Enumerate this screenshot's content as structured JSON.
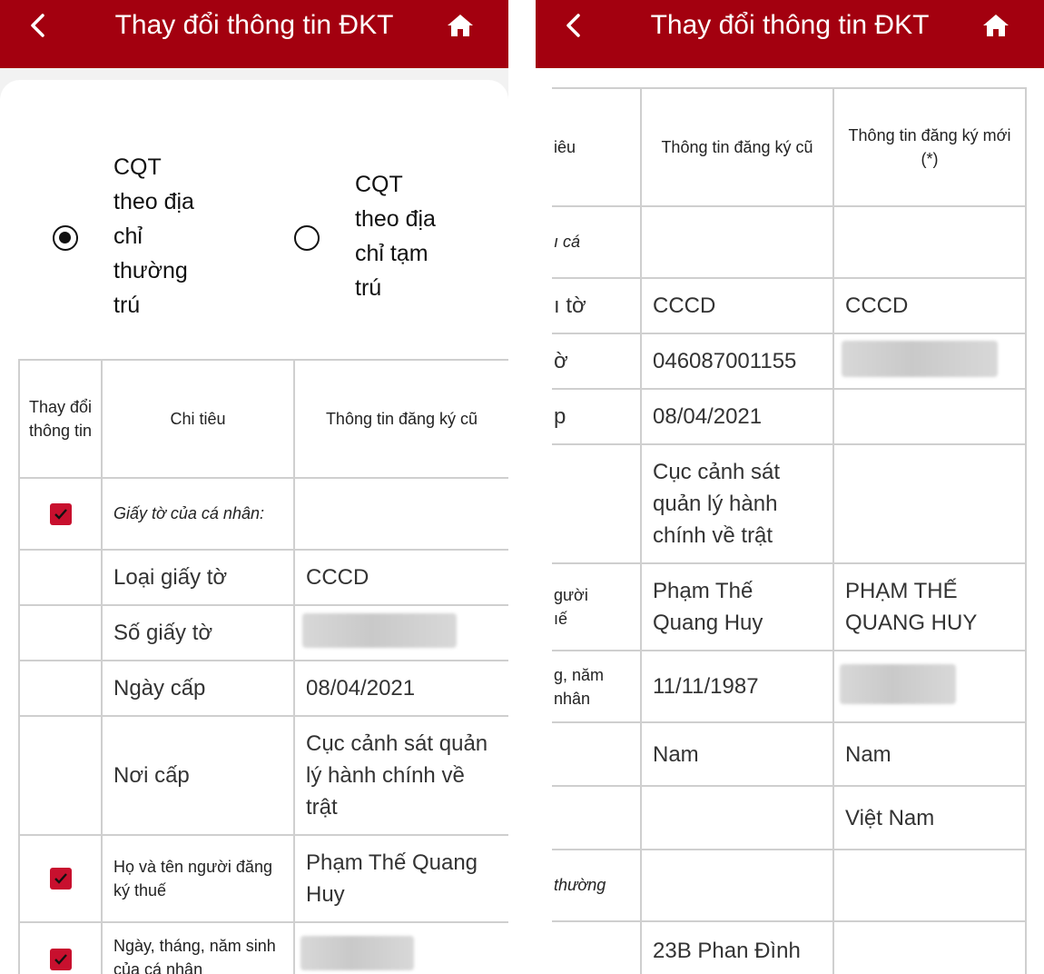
{
  "header": {
    "title": "Thay đổi thông tin ĐKT"
  },
  "options": [
    {
      "label": "CQT\ntheo địa\nchỉ\nthường\ntrú",
      "selected": true
    },
    {
      "label": "CQT\ntheo địa\nchỉ tạm\ntrú",
      "selected": false
    }
  ],
  "columns": {
    "change": "Thay đổi thông tin",
    "field": "Chi tiêu",
    "old": "Thông tin đăng ký cũ",
    "new": "Thông tin đăng ký mới (*)"
  },
  "rows": [
    {
      "field": "Giấy tờ của cá nhân:",
      "checked": true,
      "old": "",
      "new": ""
    },
    {
      "field": "Loại giấy tờ",
      "checked": false,
      "old": "CCCD",
      "new": "CCCD"
    },
    {
      "field": "Số giấy tờ",
      "checked": false,
      "old": "046087001155",
      "new": ""
    },
    {
      "field": "Ngày cấp",
      "checked": false,
      "old": "08/04/2021",
      "new": ""
    },
    {
      "field": "Nơi cấp",
      "checked": false,
      "old": "Cục cảnh sát quản lý hành chính về trật",
      "new": ""
    },
    {
      "field": "Họ và tên người đăng ký thuế",
      "checked": true,
      "old": "Phạm Thế Quang Huy",
      "new": "PHẠM THẾ QUANG HUY"
    },
    {
      "field": "Ngày, tháng, năm sinh của cá nhân",
      "checked": true,
      "old": "11/11/1987",
      "new": ""
    },
    {
      "field": "",
      "checked": false,
      "old": "Nam",
      "new": "Nam"
    },
    {
      "field": "",
      "checked": false,
      "old": "",
      "new": "Việt Nam"
    },
    {
      "field": "thường",
      "checked": false,
      "old": "",
      "new": ""
    },
    {
      "field": "",
      "checked": false,
      "old": "23B Phan Đình",
      "new": ""
    }
  ],
  "right_partial_labels": [
    "iêu",
    "ı cá",
    "ı tờ",
    "ờ",
    "p",
    "gười\nıế",
    "g, năm\nnhân",
    "thường"
  ],
  "colors": {
    "header": "#a3000f",
    "checkbox": "#c8102e",
    "border": "#cfcfcf"
  },
  "icons": [
    "back-arrow-icon",
    "home-icon",
    "radio-selected-icon",
    "radio-unselected-icon",
    "checkbox-checked-icon"
  ]
}
